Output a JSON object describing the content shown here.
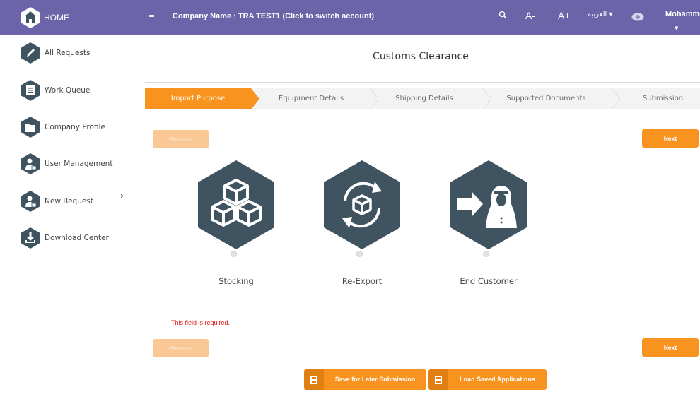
{
  "header": {
    "home_label": "HOME",
    "menu_icon": "≡",
    "company": "Company Name : TRA TEST1 (Click to switch account)",
    "font_decrease": "A-",
    "font_increase": "A+",
    "language": "العربية ▾",
    "user_name": "Mohammed",
    "user_caret": "▼",
    "bg_color": "#6b64a8"
  },
  "sidebar": {
    "items": [
      {
        "label": "All Requests",
        "icon": "pen-icon"
      },
      {
        "label": "Work Queue",
        "icon": "list-icon"
      },
      {
        "label": "Company Profile",
        "icon": "folder-icon"
      },
      {
        "label": "User Management",
        "icon": "user-lock-icon"
      },
      {
        "label": "New Request",
        "icon": "user-lock-icon"
      },
      {
        "label": "Download Center",
        "icon": "download-icon"
      }
    ],
    "expand_chevron": "›"
  },
  "main": {
    "title": "Customs Clearance",
    "steps": [
      {
        "label": "Import Purpose",
        "active": true
      },
      {
        "label": "Equipment Details",
        "active": false
      },
      {
        "label": "Shipping Details",
        "active": false
      },
      {
        "label": "Supported Documents",
        "active": false
      },
      {
        "label": "Submission",
        "active": false
      }
    ],
    "previous_label": "Previous",
    "next_label": "Next",
    "options": [
      {
        "label": "Stocking",
        "icon": "boxes-icon"
      },
      {
        "label": "Re-Export",
        "icon": "box-cycle-icon"
      },
      {
        "label": "End Customer",
        "icon": "customer-arrow-icon"
      }
    ],
    "error_text": "This field is required.",
    "save_later_label": "Save for Later Submission",
    "load_saved_label": "Load Saved Applications",
    "accent_color": "#f7931e",
    "hex_color": "#3f5360"
  }
}
